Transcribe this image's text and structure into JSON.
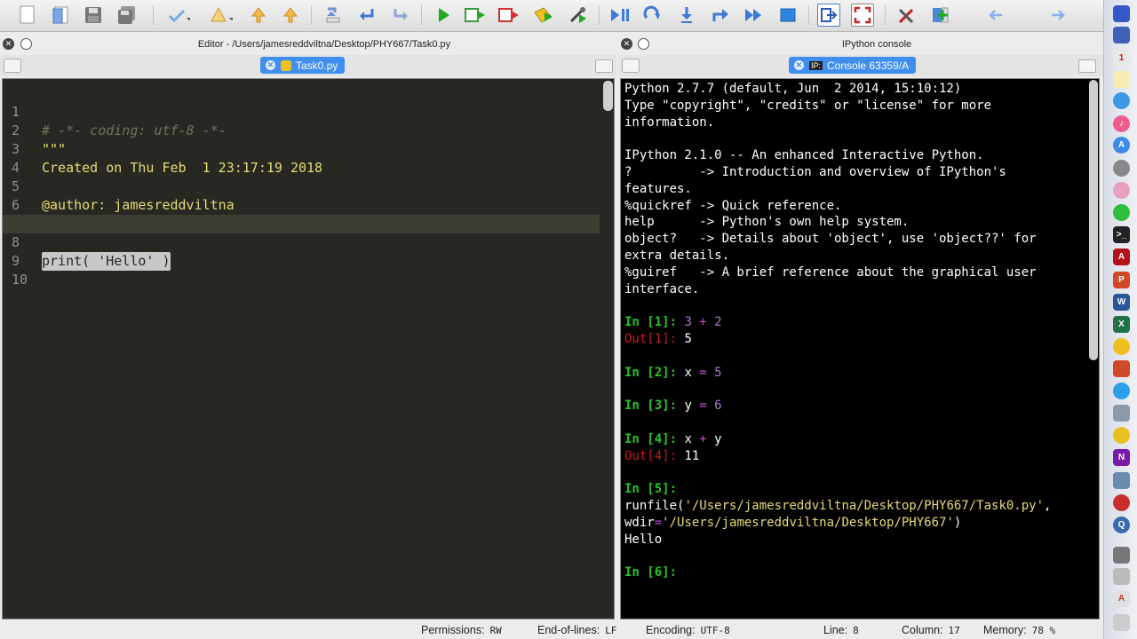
{
  "toolbar": {
    "icons": [
      "new-file",
      "open-file",
      "save",
      "save-all",
      "toggle-comment",
      "warning",
      "previous-warning",
      "next-warning",
      "last-edit",
      "back",
      "forward",
      "run",
      "run-cell",
      "run-cell-advance",
      "run-selection",
      "configure-run",
      "debug",
      "step",
      "step-into",
      "step-return",
      "continue",
      "stop-debug",
      "maximize-pane",
      "fullscreen",
      "preferences",
      "python-path",
      "back-arrow",
      "forward-arrow"
    ]
  },
  "editor": {
    "title": "Editor - /Users/jamesreddviltna/Desktop/PHY667/Task0.py",
    "tab_label": "Task0.py",
    "lines": [
      {
        "num": "1",
        "text": "# -*- coding: utf-8 -*-"
      },
      {
        "num": "2",
        "text": "\"\"\""
      },
      {
        "num": "3",
        "text": "Created on Thu Feb  1 23:17:19 2018"
      },
      {
        "num": "4",
        "text": ""
      },
      {
        "num": "5",
        "text": "@author: jamesreddviltna"
      },
      {
        "num": "6",
        "text": "\"\"\""
      },
      {
        "num": "7",
        "text": ""
      },
      {
        "num": "8",
        "text": "print( 'Hello' )"
      },
      {
        "num": "9",
        "text": ""
      },
      {
        "num": "10",
        "text": ""
      }
    ]
  },
  "console": {
    "title": "IPython console",
    "tab_label": "Console 63359/A",
    "banner": [
      "Python 2.7.7 (default, Jun  2 2014, 15:10:12)",
      "Type \"copyright\", \"credits\" or \"license\" for more",
      "information.",
      "",
      "IPython 2.1.0 -- An enhanced Interactive Python.",
      "?         -> Introduction and overview of IPython's",
      "features.",
      "%quickref -> Quick reference.",
      "help      -> Python's own help system.",
      "object?   -> Details about 'object', use 'object??' for",
      "extra details.",
      "%guiref   -> A brief reference about the graphical user",
      "interface."
    ],
    "in1_prompt": "In [1]: ",
    "in1_a": "3",
    "in1_op": " + ",
    "in1_b": "2",
    "out1_prompt": "Out[1]: ",
    "out1_val": "5",
    "in2_prompt": "In [2]: ",
    "in2_a": "x",
    "in2_op": " = ",
    "in2_b": "5",
    "in3_prompt": "In [3]: ",
    "in3_a": "y",
    "in3_op": " = ",
    "in3_b": "6",
    "in4_prompt": "In [4]: ",
    "in4_a": "x",
    "in4_op": " + ",
    "in4_b": "y",
    "out4_prompt": "Out[4]: ",
    "out4_val": "11",
    "in5_prompt": "In [5]:",
    "run_a": "runfile(",
    "run_path": "'/Users/jamesreddviltna/Desktop/PHY667/Task0.py'",
    "run_b": ",",
    "wdir_a": "wdir",
    "wdir_eq": "=",
    "wdir_path": "'/Users/jamesreddviltna/Desktop/PHY667'",
    "wdir_b": ")",
    "output": "Hello",
    "in6_prompt": "In [6]:"
  },
  "status": {
    "permissions_label": "Permissions:",
    "permissions_value": "RW",
    "eol_label": "End-of-lines:",
    "eol_value": "LF",
    "encoding_label": "Encoding:",
    "encoding_value": "UTF-8",
    "line_label": "Line:",
    "line_value": "8",
    "column_label": "Column:",
    "column_value": "17",
    "memory_label": "Memory:",
    "memory_value": "78 %"
  }
}
